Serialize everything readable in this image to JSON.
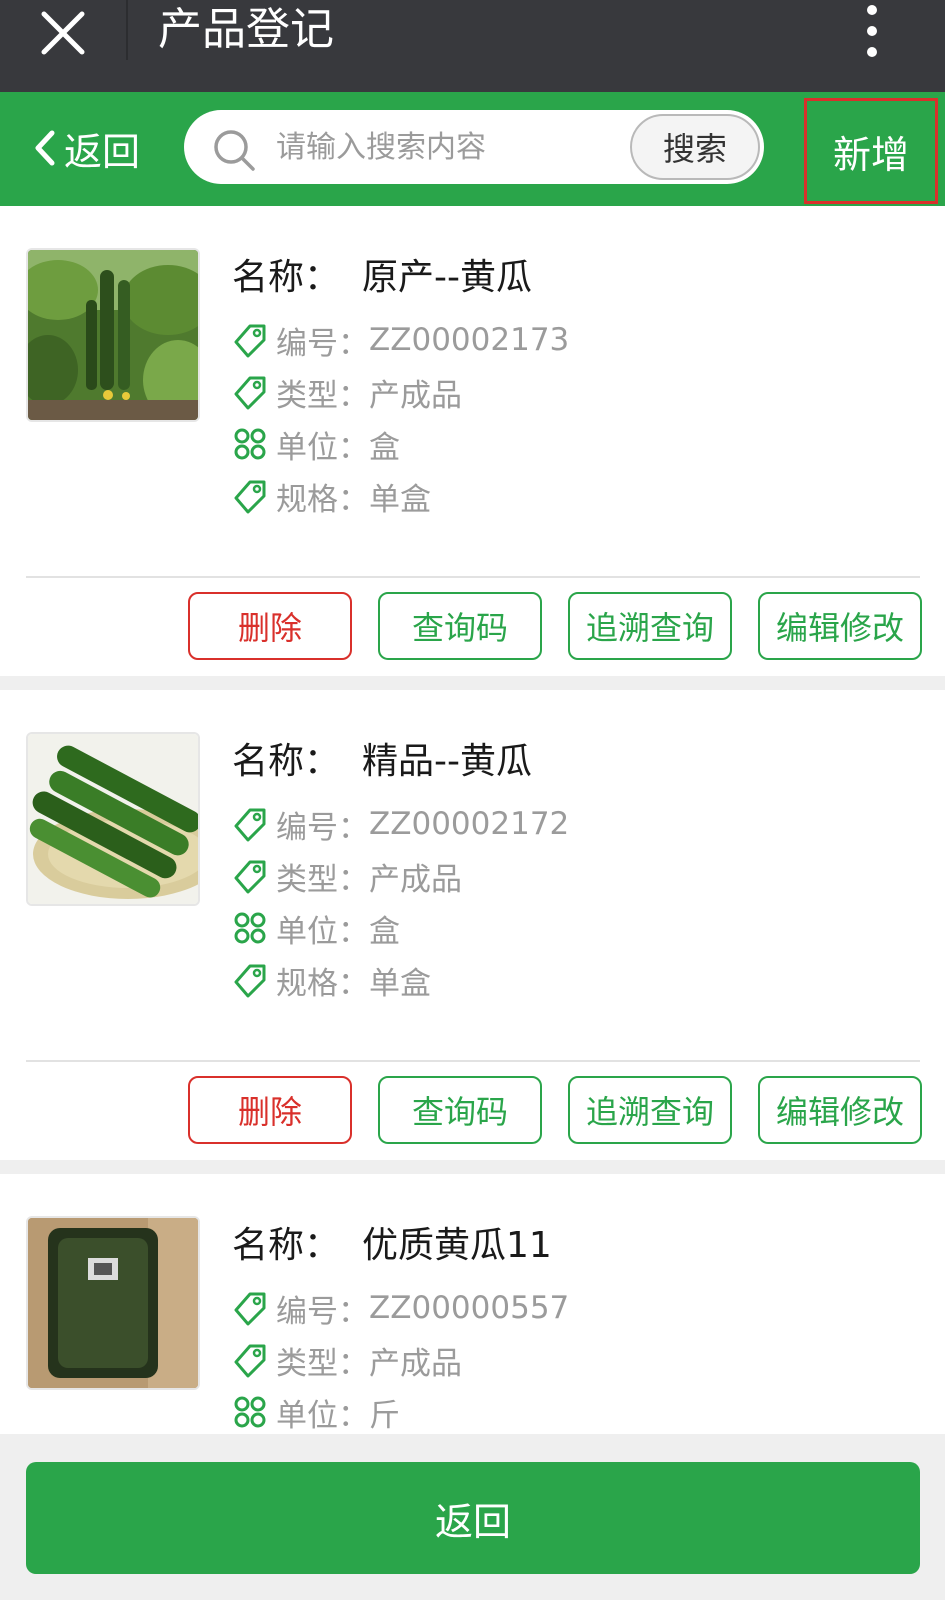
{
  "titlebar": {
    "title": "产品登记",
    "close_icon": "close-icon",
    "more_icon": "more-vertical-icon"
  },
  "header": {
    "back_label": "返回",
    "search": {
      "placeholder": "请输入搜索内容",
      "value": "",
      "button_label": "搜索"
    },
    "add_label": "新增"
  },
  "products": [
    {
      "name_label": "名称：",
      "name": "原产--黄瓜",
      "code_label": "编号：",
      "code": "ZZ00002173",
      "type_label": "类型：",
      "type": "产成品",
      "unit_label": "单位：",
      "unit": "盒",
      "spec_label": "规格：",
      "spec": "单盒",
      "image": "cucumber-plant-photo"
    },
    {
      "name_label": "名称：",
      "name": "精品--黄瓜",
      "code_label": "编号：",
      "code": "ZZ00002172",
      "type_label": "类型：",
      "type": "产成品",
      "unit_label": "单位：",
      "unit": "盒",
      "spec_label": "规格：",
      "spec": "单盒",
      "image": "cucumbers-on-plate-photo"
    },
    {
      "name_label": "名称：",
      "name": "优质黄瓜11",
      "code_label": "编号：",
      "code": "ZZ00000557",
      "type_label": "类型：",
      "type": "产成品",
      "unit_label": "单位：",
      "unit": "斤",
      "spec_label": "",
      "spec": "",
      "image": "packaged-cucumber-photo"
    }
  ],
  "actions": {
    "delete": "删除",
    "query_code": "查询码",
    "trace_query": "追溯查询",
    "edit": "编辑修改"
  },
  "footer": {
    "back_label": "返回"
  },
  "colors": {
    "green": "#2aa54a",
    "red": "#d9302b",
    "titlebar": "#38393d",
    "gray_text": "#9b9b9b"
  }
}
